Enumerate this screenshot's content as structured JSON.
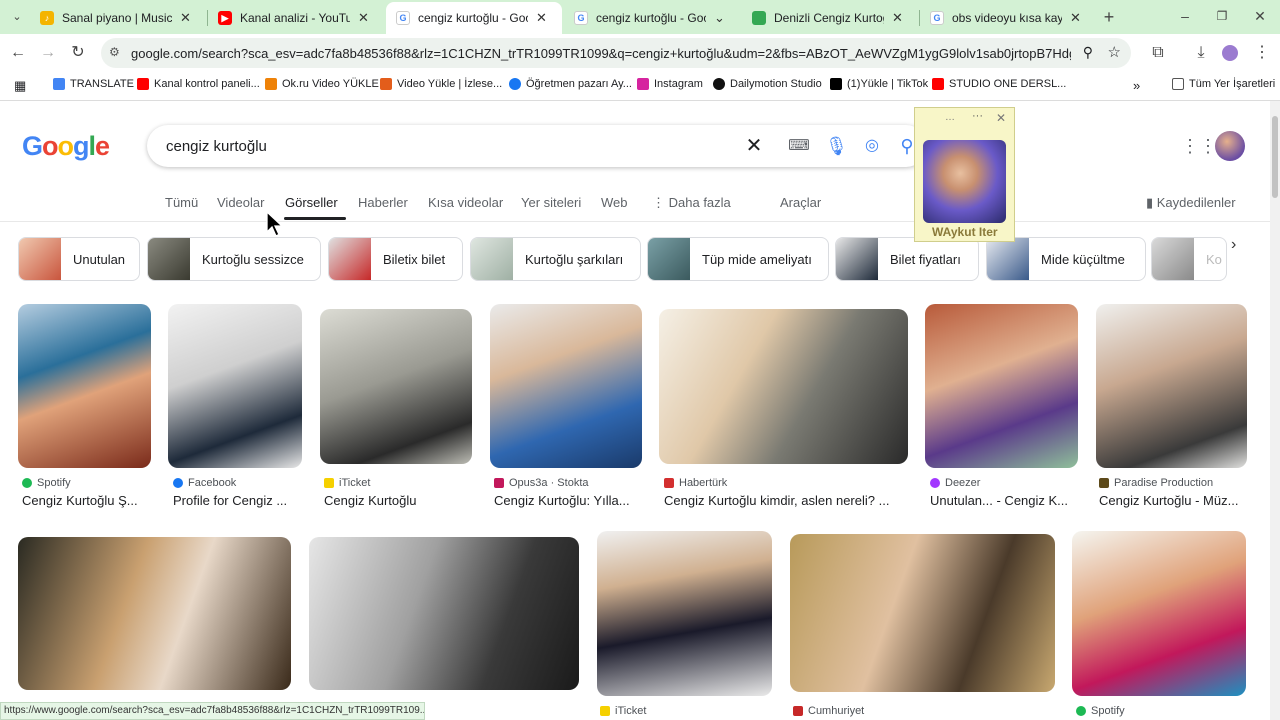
{
  "tabs": [
    {
      "title": "Sanal piyano | Musicca",
      "fav_color": "#f4b400"
    },
    {
      "title": "Kanal analizi - YouTube Stu",
      "fav_color": "#ff0000"
    },
    {
      "title": "cengiz kurtoğlu - Google'd",
      "fav_color": "#4285f4"
    },
    {
      "title": "cengiz kurtoğlu - Google'd",
      "fav_color": "#4285f4"
    },
    {
      "title": "Denizli Cengiz Kurtoğlu Ye",
      "fav_color": "#34a853"
    },
    {
      "title": "obs videoyu kısa kaydediy",
      "fav_color": "#4285f4"
    }
  ],
  "toolbar": {
    "url": "google.com/search?sca_esv=adc7fa8b48536f88&rlz=1C1CHZN_trTR1099TR1099&q=cengiz+kurtoğlu&udm=2&fbs=ABzOT_AeWVZgM1ygG9lolv1sab0jrtopB7HdgbCfCA6R89jSDRt..."
  },
  "bookmarks": [
    {
      "label": "TRANSLATE",
      "color": "#4285f4"
    },
    {
      "label": "Kanal kontrol paneli...",
      "color": "#ff0000"
    },
    {
      "label": "Ok.ru Video YÜKLE",
      "color": "#ee8208"
    },
    {
      "label": "Video Yükle | İzlese...",
      "color": "#e35d1b"
    },
    {
      "label": "Öğretmen pazarı Ay...",
      "color": "#1877f2"
    },
    {
      "label": "Instagram",
      "color": "#d6249f"
    },
    {
      "label": "Dailymotion Studio",
      "color": "#111111"
    },
    {
      "label": "(1)Yükle | TikTok",
      "color": "#000000"
    },
    {
      "label": "STUDIO ONE DERSL...",
      "color": "#ff0000"
    }
  ],
  "bookmarks_all": "Tüm Yer İşaretleri",
  "search": {
    "query": "cengiz kurtoğlu"
  },
  "nav_tabs": [
    "Tümü",
    "Videolar",
    "Görseller",
    "Haberler",
    "Kısa videolar",
    "Yer siteleri",
    "Web",
    "Daha fazla",
    "Araçlar"
  ],
  "saved_label": "Kaydedilenler",
  "chips": [
    "Unutulan",
    "Kurtoğlu sessizce",
    "Biletix bilet",
    "Kurtoğlu şarkıları",
    "Tüp mide ameliyatı",
    "Bilet fiyatları",
    "Mide küçültme",
    "Ko"
  ],
  "row1": [
    {
      "source": "Spotify",
      "caption": "Cengiz Kurtoğlu Ş...",
      "icon_color": "#1db954"
    },
    {
      "source": "Facebook",
      "caption": "Profile for Cengiz ...",
      "icon_color": "#1877f2"
    },
    {
      "source": "iTicket",
      "caption": "Cengiz Kurtoğlu",
      "icon_color": "#f5d000"
    },
    {
      "source": "Opus3a · Stokta",
      "caption": "Cengiz Kurtoğlu: Yılla...",
      "icon_color": "#c2185b"
    },
    {
      "source": "Habertürk",
      "caption": "Cengiz Kurtoğlu kimdir, aslen nereli? ...",
      "icon_color": "#d32f2f"
    },
    {
      "source": "Deezer",
      "caption": "Unutulan... - Cengiz K...",
      "icon_color": "#a238ff"
    },
    {
      "source": "Paradise Production",
      "caption": "Cengiz Kurtoğlu - Müz...",
      "icon_color": "#5d4a1a"
    }
  ],
  "row2_sources": [
    {
      "source": "iTicket",
      "icon_color": "#f5d000"
    },
    {
      "source": "Cumhuriyet",
      "icon_color": "#c62828"
    },
    {
      "source": "Spotify",
      "icon_color": "#1db954"
    }
  ],
  "overlay": {
    "name": "WAykut Iter"
  },
  "status_url": "https://www.google.com/search?sca_esv=adc7fa8b48536f88&rlz=1C1CHZN_trTR1099TR109..."
}
